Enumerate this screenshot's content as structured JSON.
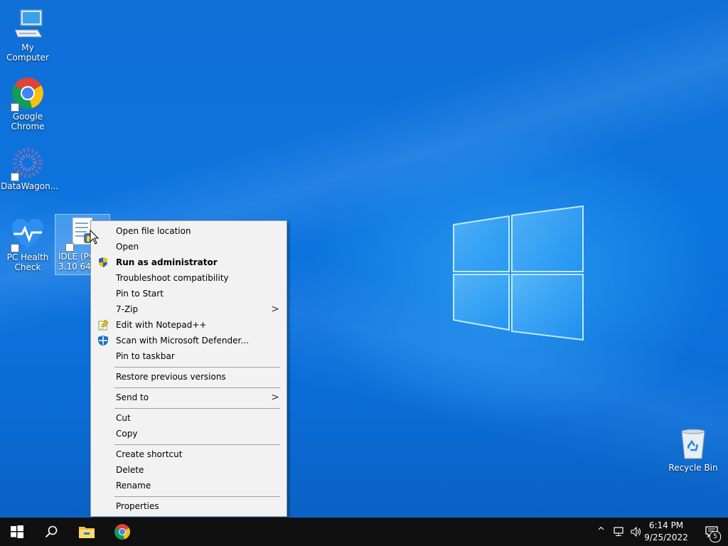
{
  "desktop": {
    "icons": [
      {
        "label": "My Computer",
        "icon": "computer-icon"
      },
      {
        "label": "Google Chrome",
        "icon": "chrome-icon"
      },
      {
        "label": "DataWagon...",
        "icon": "datawagon-icon"
      },
      {
        "label": "PC Health Check",
        "icon": "heart-monitor-icon"
      },
      {
        "label": "IDLE (Py 3.10 64-",
        "icon": "python-idle-icon",
        "selected": true
      },
      {
        "label": "Recycle Bin",
        "icon": "recycle-bin-icon"
      }
    ]
  },
  "context_menu": {
    "items": [
      {
        "label": "Open file location"
      },
      {
        "label": "Open"
      },
      {
        "label": "Run as administrator",
        "icon": "uac-shield-icon",
        "bold": true
      },
      {
        "label": "Troubleshoot compatibility"
      },
      {
        "label": "Pin to Start"
      },
      {
        "label": "7-Zip",
        "submenu": true
      },
      {
        "label": "Edit with Notepad++",
        "icon": "notepad-plus-plus-icon"
      },
      {
        "label": "Scan with Microsoft Defender...",
        "icon": "defender-shield-icon"
      },
      {
        "label": "Pin to taskbar"
      },
      {
        "label": "Restore previous versions"
      },
      {
        "label": "Send to",
        "submenu": true
      },
      {
        "label": "Cut"
      },
      {
        "label": "Copy"
      },
      {
        "label": "Create shortcut"
      },
      {
        "label": "Delete"
      },
      {
        "label": "Rename"
      },
      {
        "label": "Properties"
      }
    ],
    "submenu_arrow": ">"
  },
  "taskbar": {
    "start_icon": "windows-start-icon",
    "search_icon": "search-icon",
    "pinned": [
      "file-explorer-icon",
      "chrome-icon"
    ],
    "tray": {
      "chevron": "^",
      "network_icon": "network-icon",
      "volume_icon": "volume-icon"
    },
    "clock": {
      "time": "6:14 PM",
      "date": "9/25/2022"
    },
    "notifications": {
      "icon": "notification-center-icon",
      "count": "5"
    }
  },
  "colors": {
    "desktop_blue": "#0c74df",
    "menu_bg": "#f2f2f2",
    "taskbar_bg": "#101010"
  }
}
